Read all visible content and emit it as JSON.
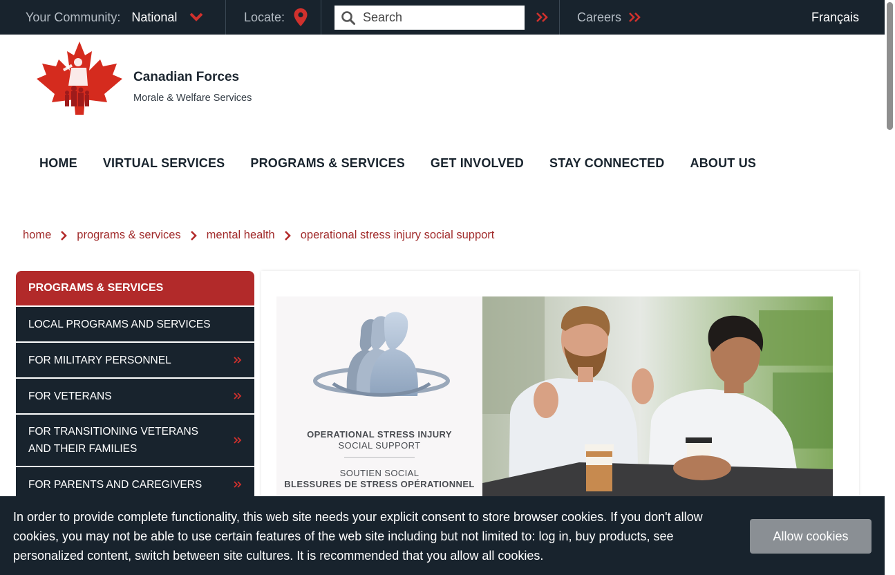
{
  "topbar": {
    "community_label": "Your Community:",
    "community_value": "National",
    "locate_label": "Locate:",
    "search_placeholder": "Search",
    "careers_label": "Careers",
    "language_link": "Français"
  },
  "brand": {
    "title": "Canadian Forces",
    "subtitle": "Morale & Welfare Services"
  },
  "nav": {
    "items": [
      "HOME",
      "VIRTUAL SERVICES",
      "PROGRAMS & SERVICES",
      "GET INVOLVED",
      "STAY CONNECTED",
      "ABOUT US"
    ]
  },
  "breadcrumb": {
    "items": [
      "home",
      "programs & services",
      "mental health",
      "operational stress injury social support"
    ]
  },
  "sidebar": {
    "heading": "PROGRAMS & SERVICES",
    "items": [
      {
        "label": "LOCAL PROGRAMS AND SERVICES",
        "has_arrow": false
      },
      {
        "label": "FOR MILITARY PERSONNEL",
        "has_arrow": true
      },
      {
        "label": "FOR VETERANS",
        "has_arrow": true
      },
      {
        "label": "FOR TRANSITIONING VETERANS AND THEIR FAMILIES",
        "has_arrow": true
      },
      {
        "label": "FOR PARENTS AND CAREGIVERS",
        "has_arrow": true
      }
    ]
  },
  "banner_image": {
    "line1": "OPERATIONAL STRESS INJURY",
    "line2": "SOCIAL SUPPORT",
    "line3": "SOUTIEN SOCIAL",
    "line4": "BLESSURES DE STRESS OPÉRATIONNEL"
  },
  "cookie": {
    "message": "In order to provide complete functionality, this web site needs your explicit consent to store browser cookies. If you don't allow cookies, you may not be able to use certain features of the web site including but not limited to: log in, buy products, see personalized content, switch between site cultures. It is recommended that you allow all cookies.",
    "button_label": "Allow cookies"
  },
  "colors": {
    "dark_navy": "#18232d",
    "brand_red": "#b22a2a",
    "link_red": "#a12b2b",
    "button_grey": "#8a8f94"
  },
  "icons": {
    "community": "chevron-down-icon",
    "locate": "map-pin-icon",
    "search": "search-icon",
    "submit": "double-chevron-right-icon",
    "careers": "double-chevron-right-icon",
    "breadcrumb_separator": "chevron-right-icon",
    "sidebar_arrow": "double-chevron-right-icon"
  }
}
